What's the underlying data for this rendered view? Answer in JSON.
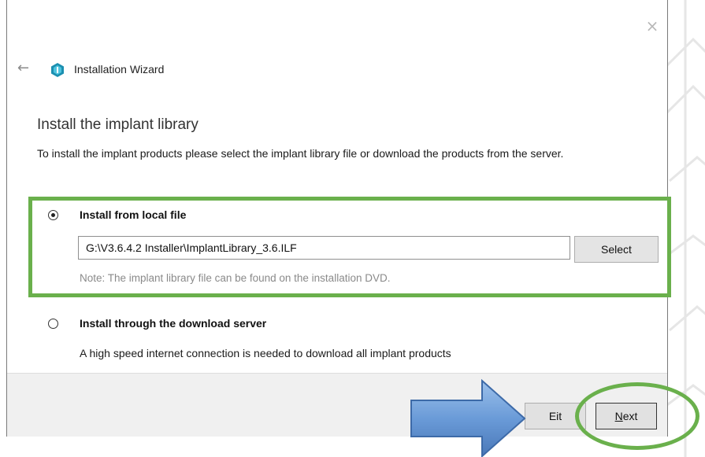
{
  "window": {
    "title": "Installation Wizard",
    "close_glyph": "×",
    "back_glyph": "←",
    "logo_icon": "app-logo-icon"
  },
  "page": {
    "heading": "Install the implant library",
    "description": "To install the implant products please select the implant library file or download the products from the server."
  },
  "options": {
    "local": {
      "label": "Install from local file",
      "selected": true,
      "file_path": "G:\\V3.6.4.2 Installer\\ImplantLibrary_3.6.ILF",
      "select_label": "Select",
      "note": "Note: The implant library file can be found on the installation DVD."
    },
    "server": {
      "label": "Install through the download server",
      "selected": false,
      "description": "A high speed internet connection is needed to download all implant products"
    }
  },
  "footer": {
    "exit_label_prefix": "E",
    "exit_label_suffix": "it",
    "next_label_underline": "N",
    "next_label_rest": "ext"
  },
  "annotations": {
    "highlight_color": "#6ab04c",
    "arrow_color": "#6a9bd8",
    "arrow_icon": "right-arrow-annotation"
  }
}
